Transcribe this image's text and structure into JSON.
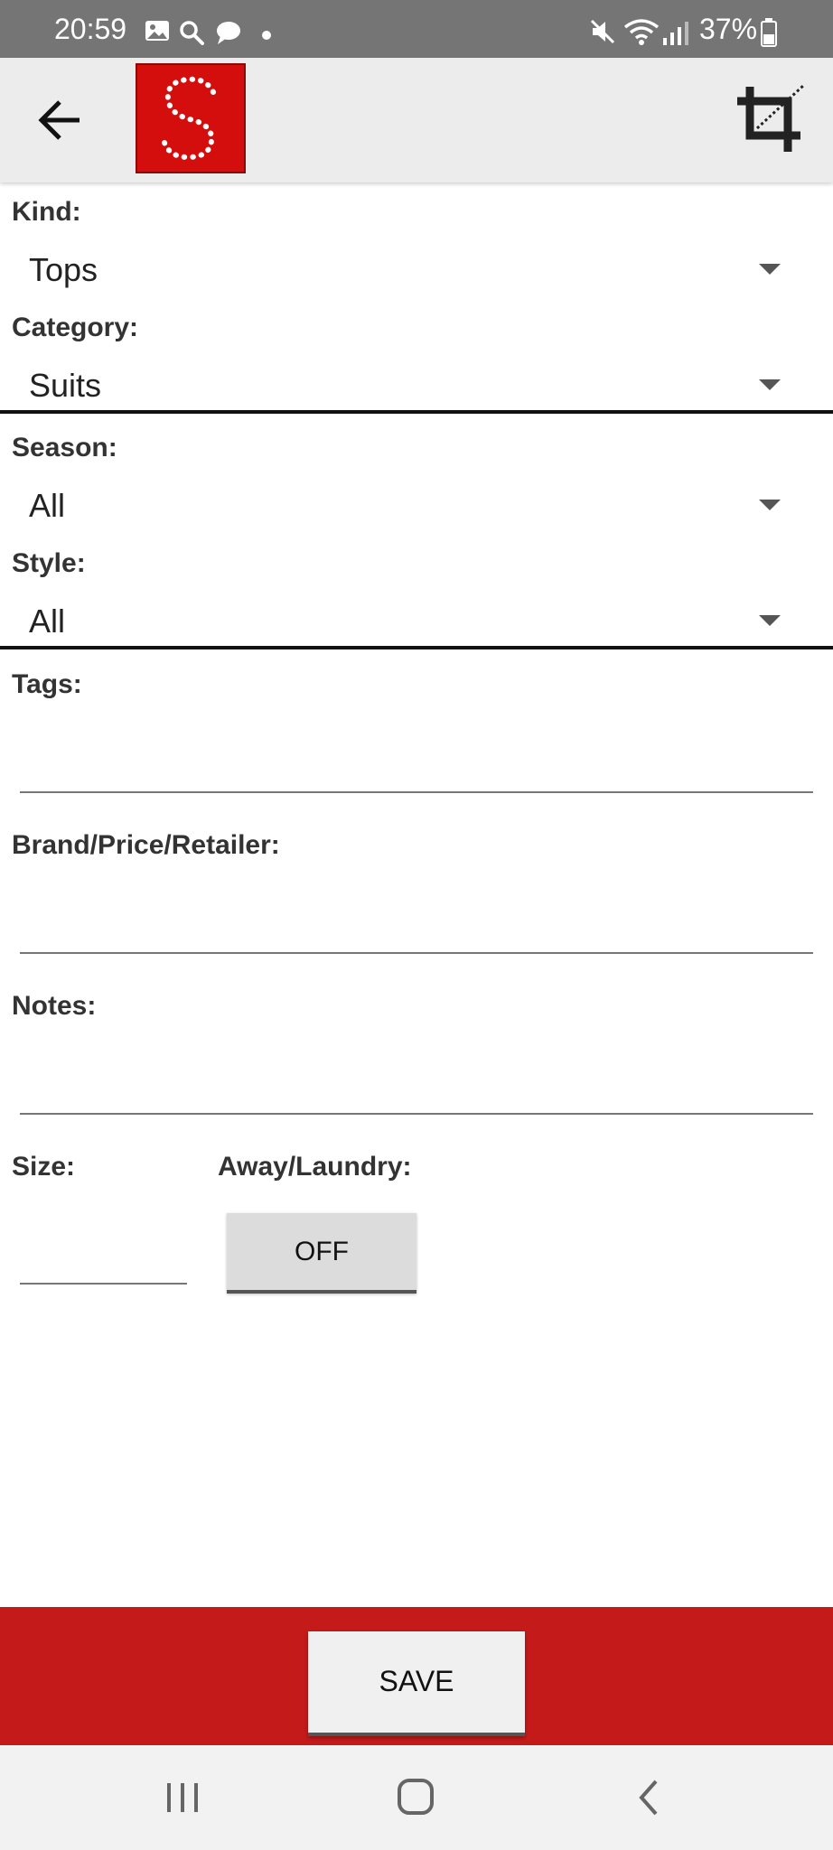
{
  "status_bar": {
    "time": "20:59",
    "battery": "37%",
    "left_icons": [
      "gallery-icon",
      "search-icon",
      "chat-bubble-icon",
      "dot-icon"
    ],
    "right_icons": [
      "mute-icon",
      "wifi-icon",
      "signal-icon",
      "battery-icon"
    ]
  },
  "app_bar": {
    "logo_letter": "S",
    "brand_color": "#d40d0d"
  },
  "form": {
    "kind": {
      "label": "Kind:",
      "value": "Tops"
    },
    "category": {
      "label": "Category:",
      "value": "Suits"
    },
    "season": {
      "label": "Season:",
      "value": "All"
    },
    "style": {
      "label": "Style:",
      "value": "All"
    },
    "tags": {
      "label": "Tags:",
      "value": ""
    },
    "brand": {
      "label": "Brand/Price/Retailer:",
      "value": ""
    },
    "notes": {
      "label": "Notes:",
      "value": ""
    },
    "size": {
      "label": "Size:",
      "value": ""
    },
    "away": {
      "label": "Away/Laundry:",
      "toggle": "OFF"
    }
  },
  "save_bar": {
    "save_label": "SAVE",
    "color": "#c41a1a"
  },
  "nav_bar": {
    "buttons": [
      "recent-apps-icon",
      "home-icon",
      "back-nav-icon"
    ]
  }
}
